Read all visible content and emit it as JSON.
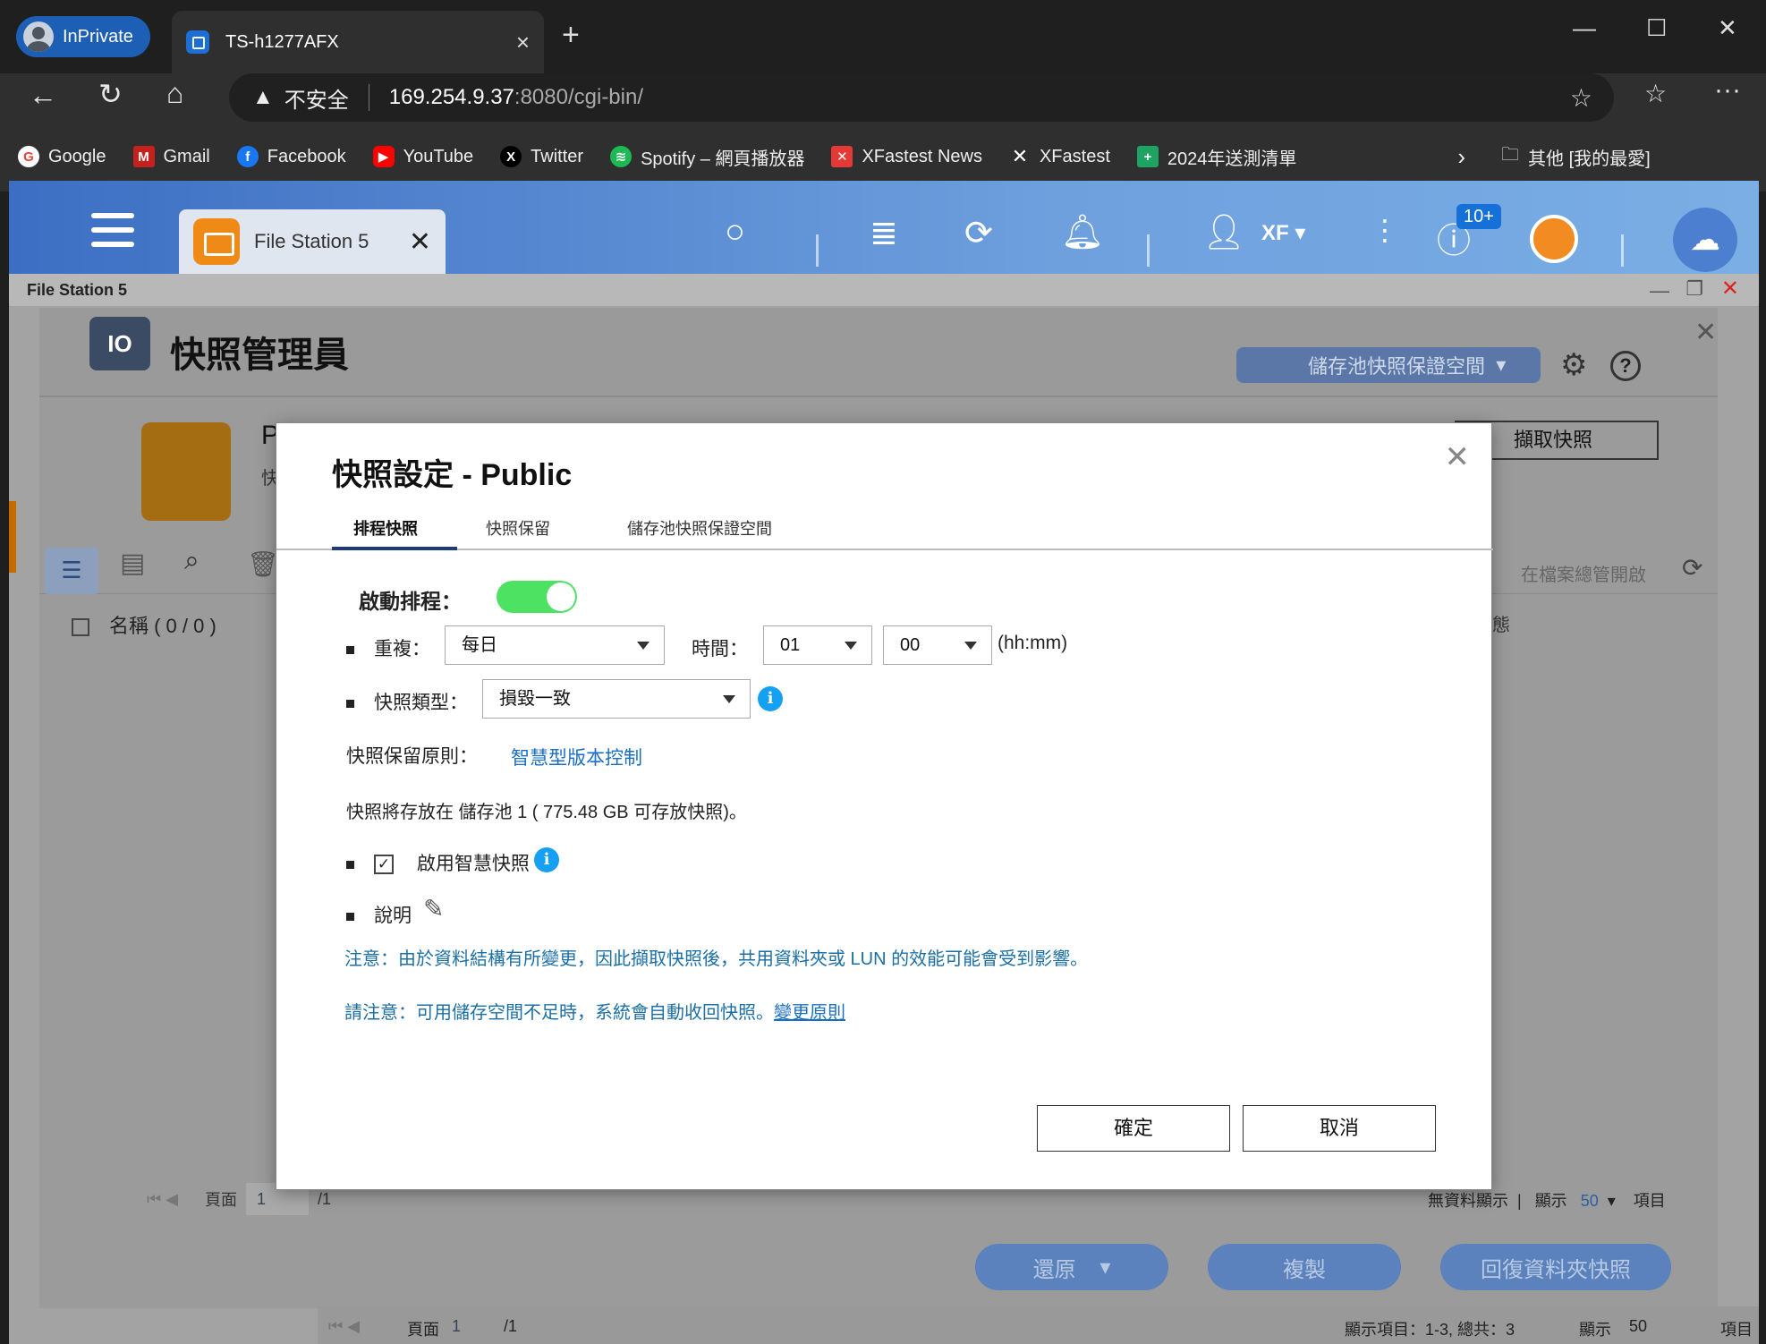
{
  "browser": {
    "profile_label": "InPrivate",
    "tab_title": "TS-h1277AFX",
    "tab_close": "×",
    "new_tab": "+",
    "win_min": "—",
    "win_max": "☐",
    "win_close": "✕",
    "security_label": "不安全",
    "url_host": "169.254.9.37",
    "url_path": ":8080/cgi-bin/",
    "bookmarks": [
      {
        "label": "Google",
        "icon": "google-icon",
        "color": "#ea4335"
      },
      {
        "label": "Gmail",
        "icon": "gmail-icon",
        "color": "#c5221f"
      },
      {
        "label": "Facebook",
        "icon": "facebook-icon",
        "color": "#1877f2"
      },
      {
        "label": "YouTube",
        "icon": "youtube-icon",
        "color": "#ff0000"
      },
      {
        "label": "Twitter",
        "icon": "x-twitter-icon",
        "color": "#000000"
      },
      {
        "label": "Spotify – 網頁播放器",
        "icon": "spotify-icon",
        "color": "#1db954"
      },
      {
        "label": "XFastest News",
        "icon": "xfastest-icon",
        "color": "#e53935"
      },
      {
        "label": "XFastest",
        "icon": "xfastest-icon",
        "color": "#111111"
      },
      {
        "label": "2024年送測清單",
        "icon": "sheets-icon",
        "color": "#1ea362"
      }
    ],
    "bookmarks_more": "其他 [我的最愛]"
  },
  "qts": {
    "app_tab_label": "File Station 5",
    "user_label": "XF",
    "notif_badge": "10+",
    "window_title": "File Station 5"
  },
  "snapshot_manager": {
    "title": "快照管理員",
    "pool_selector": "儲存池快照保證空間",
    "take_snapshot": "擷取快照",
    "open_in_fs": "在檔案總管開啟",
    "name_header": "名稱 ( 0 / 0 )",
    "status_header_partial": "態",
    "folder_initial": "P",
    "folder_sub_initial": "快",
    "pager": {
      "page_label": "頁面",
      "page_value": "1",
      "page_total": "/1",
      "no_data": "無資料顯示",
      "show_label": "顯示",
      "show_value": "50",
      "items_label": "項目"
    },
    "actions": {
      "restore": "還原",
      "copy": "複製",
      "revert": "回復資料夾快照"
    }
  },
  "bottom_pager": {
    "page_label": "頁面",
    "page_value": "1",
    "page_total": "/1",
    "range": "顯示項目：1-3, 總共：3",
    "show_label": "顯示",
    "show_value": "50",
    "items_label": "項目"
  },
  "dialog": {
    "title": "快照設定 - Public",
    "tabs": [
      "排程快照",
      "快照保留",
      "儲存池快照保證空間"
    ],
    "enable_schedule_label": "啟動排程：",
    "enable_schedule_on": true,
    "repeat_label": "重複：",
    "repeat_value": "每日",
    "time_label": "時間：",
    "hour_value": "01",
    "minute_value": "00",
    "time_format": "(hh:mm)",
    "type_label": "快照類型：",
    "type_value": "損毀一致",
    "retention_label": "快照保留原則：",
    "retention_link": "智慧型版本控制",
    "storage_text": "快照將存放在 儲存池 1 ( 775.48 GB 可存放快照)。",
    "smart_snapshot_label": "啟用智慧快照",
    "smart_snapshot_checked": true,
    "desc_label": "說明",
    "note1": "注意：由於資料結構有所變更，因此擷取快照後，共用資料夾或 LUN 的效能可能會受到影響。",
    "note2_prefix": "請注意：可用儲存空間不足時，系統會自動收回快照。",
    "note2_link": "變更原則",
    "ok": "確定",
    "cancel": "取消"
  }
}
